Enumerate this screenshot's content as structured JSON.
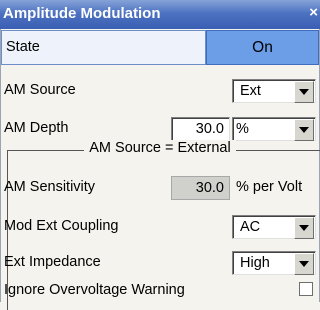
{
  "window": {
    "title": "Amplitude Modulation",
    "close_glyph": "×"
  },
  "state": {
    "label": "State",
    "value": "On"
  },
  "am_source": {
    "label": "AM Source",
    "value": "Ext"
  },
  "am_depth": {
    "label": "AM Depth",
    "value": "30.0",
    "unit": "%"
  },
  "group": {
    "legend": "AM Source = External"
  },
  "am_sensitivity": {
    "label": "AM Sensitivity",
    "value": "30.0",
    "unit": "% per Volt"
  },
  "mod_ext_coupling": {
    "label": "Mod Ext Coupling",
    "value": "AC"
  },
  "ext_impedance": {
    "label": "Ext Impedance",
    "value": "High"
  },
  "ignore_overvoltage": {
    "label": "Ignore Overvoltage Warning",
    "checked": false
  },
  "colors": {
    "title_bar": "#4d72c1",
    "state_on": "#6b9ee6",
    "background": "#f4f3ee"
  }
}
